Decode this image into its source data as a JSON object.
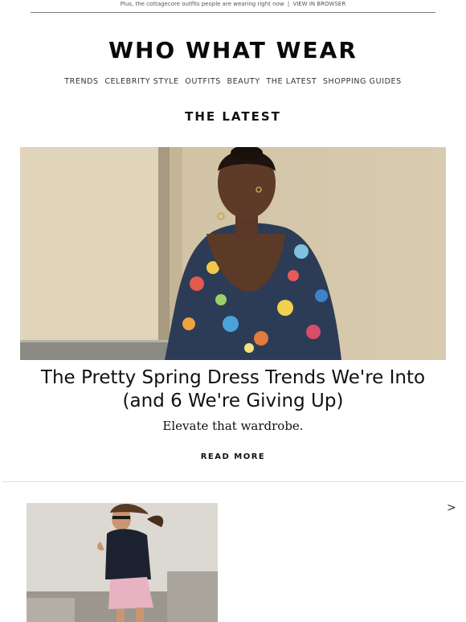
{
  "preheader": {
    "text": "Plus, the cottagecore outfits people are wearing right now",
    "separator": "|",
    "link": "VIEW IN BROWSER"
  },
  "brand": {
    "logo": "WHO WHAT WEAR"
  },
  "nav": {
    "items": [
      "TRENDS",
      "CELEBRITY STYLE",
      "OUTFITS",
      "BEAUTY",
      "THE LATEST",
      "SHOPPING GUIDES"
    ]
  },
  "section": {
    "title": "THE LATEST"
  },
  "feature": {
    "image_icon": "woman-in-floral-dress-photo",
    "headline_line1": "The Pretty Spring Dress Trends We're Into",
    "headline_line2": "(and 6 We're Giving Up)",
    "dek": "Elevate that wardrobe.",
    "cta": "READ MORE"
  },
  "next_story": {
    "image_icon": "woman-in-pink-skirt-photo",
    "arrow": ">"
  },
  "colors": {
    "text": "#111111",
    "divider": "#dddddd",
    "hero_wall": "#d6c9ad"
  }
}
